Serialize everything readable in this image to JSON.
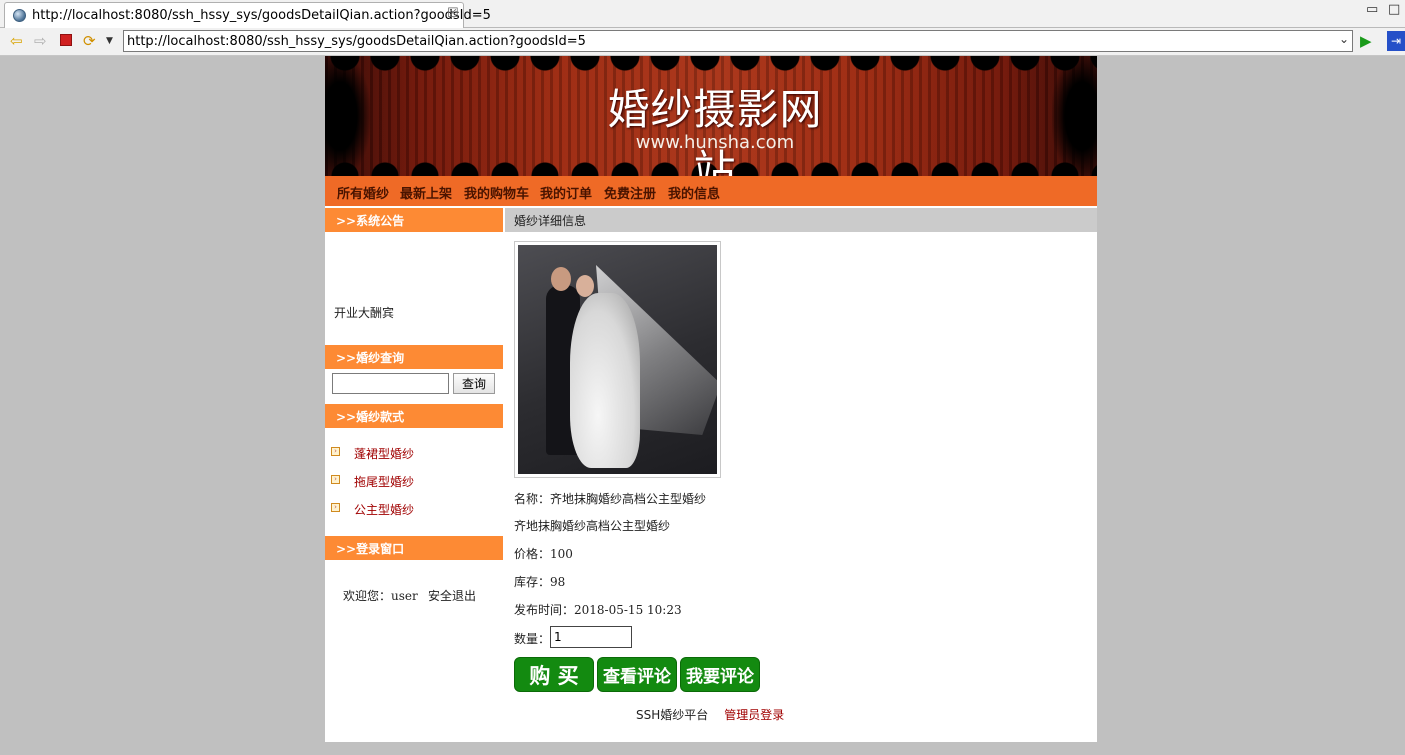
{
  "browser": {
    "tab_title": "http://localhost:8080/ssh_hssy_sys/goodsDetailQian.action?goodsId=5",
    "tab_close": "☒",
    "url": "http://localhost:8080/ssh_hssy_sys/goodsDetailQian.action?goodsId=5",
    "minimize": "▭",
    "maximize": "□"
  },
  "site": {
    "title": "婚纱摄影网站",
    "subtitle": "www.hunsha.com"
  },
  "nav": {
    "items": [
      "所有婚纱",
      "最新上架",
      "我的购物车",
      "我的订单",
      "免费注册",
      "我的信息"
    ]
  },
  "sidebar": {
    "notice_head": ">>系统公告",
    "notice_text": "开业大酬宾",
    "search_head": ">>婚纱查询",
    "search_value": "",
    "search_button": "查询",
    "category_head": ">>婚纱款式",
    "categories": [
      "蓬裙型婚纱",
      "拖尾型婚纱",
      "公主型婚纱"
    ],
    "login_head": ">>登录窗口",
    "welcome_label": "欢迎您：",
    "username": "user",
    "logout": "安全退出"
  },
  "detail": {
    "header": "婚纱详细信息",
    "name_label": "名称：",
    "name": "齐地抹胸婚纱高档公主型婚纱",
    "description": "齐地抹胸婚纱高档公主型婚纱",
    "price_label": "价格：",
    "price": "100",
    "stock_label": "库存：",
    "stock": "98",
    "date_label": "发布时间：",
    "date": "2018-05-15 10:23",
    "qty_label": "数量：",
    "qty": "1",
    "buy_button": "购 买",
    "view_comments_button": "查看评论",
    "add_comment_button": "我要评论"
  },
  "footer": {
    "platform": "SSH婚纱平台",
    "admin_login": "管理员登录"
  }
}
